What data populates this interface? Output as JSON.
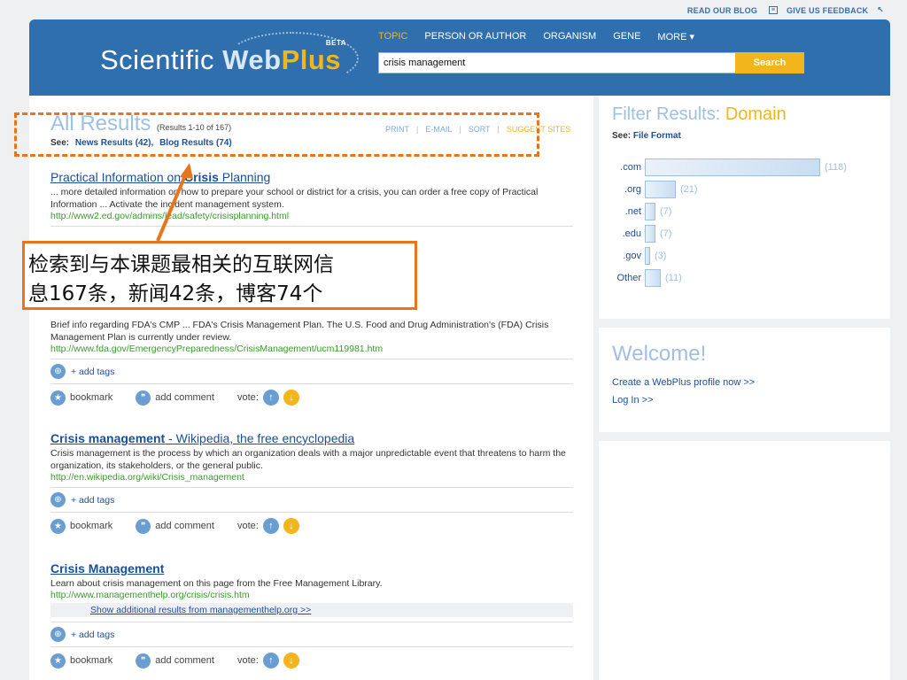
{
  "toplinks": {
    "blog": "READ OUR BLOG",
    "feedback": "GIVE US FEEDBACK"
  },
  "logo": {
    "scientific": "Scientific ",
    "web": "Web",
    "plus": "Plus",
    "beta": "BETA"
  },
  "nav": [
    "TOPIC",
    "PERSON OR AUTHOR",
    "ORGANISM",
    "GENE",
    "MORE ▾"
  ],
  "search": {
    "value": "crisis management",
    "button": "Search"
  },
  "results_header": {
    "title": "All Results",
    "count": "(Results 1-10 of 167)",
    "see_label": "See:",
    "news": "News Results (42),",
    "blog": "Blog Results (74)",
    "tools": [
      "PRINT",
      "E-MAIL",
      "SORT",
      "SUGGEST SITES"
    ]
  },
  "results": [
    {
      "title_pre": "Practical Information on ",
      "title_bold": "Crisis",
      "title_post": " Planning",
      "desc": "... more detailed information on how to prepare your school or district for a crisis, you can order a free copy of Practical Information ... Activate the incident management system.",
      "url": "http://www2.ed.gov/admins/lead/safety/crisisplanning.html"
    },
    {
      "desc": "Brief info regarding FDA's CMP ... FDA's Crisis Management Plan. The U.S. Food and Drug Administration's (FDA) Crisis Management Plan is currently under review.",
      "url": "http://www.fda.gov/EmergencyPreparedness/CrisisManagement/ucm119981.htm"
    },
    {
      "title_bold": "Crisis management",
      "title_post": " - Wikipedia, the free encyclopedia",
      "desc": "Crisis management is the process by which an organization deals with a major unpredictable event that threatens to harm the organization, its stakeholders, or the general public.",
      "url": "http://en.wikipedia.org/wiki/Crisis_management"
    },
    {
      "title_bold": "Crisis Management",
      "desc": "Learn about crisis management on this page from the Free Management Library.",
      "url": "http://www.managementhelp.org/crisis/crisis.htm",
      "more": "Show additional results from managementhelp.org >>"
    }
  ],
  "actions": {
    "add_tags": "+ add tags",
    "bookmark": "bookmark",
    "comment": "add comment",
    "vote": "vote:"
  },
  "filter": {
    "title": "Filter Results: ",
    "title_accent": "Domain",
    "see_label": "See:",
    "see_link": "File Format",
    "domains": [
      {
        "label": ".com",
        "count": "(118)",
        "value": 118
      },
      {
        "label": ".org",
        "count": "(21)",
        "value": 21
      },
      {
        "label": ".net",
        "count": "(7)",
        "value": 7
      },
      {
        "label": ".edu",
        "count": "(7)",
        "value": 7
      },
      {
        "label": ".gov",
        "count": "(3)",
        "value": 3
      },
      {
        "label": "Other",
        "count": "(11)",
        "value": 11
      }
    ]
  },
  "welcome": {
    "title": "Welcome!",
    "profile": "Create a WebPlus profile now >>",
    "login": "Log In >>"
  },
  "annotation": {
    "line1": "检索到与本课题最相关的互联网信",
    "line2": "息167条，新闻42条，博客74个"
  },
  "colors": {
    "header": "#2f6fae",
    "accent": "#f2b51c",
    "annotation": "#e8741b",
    "url": "#3a9a2c"
  }
}
